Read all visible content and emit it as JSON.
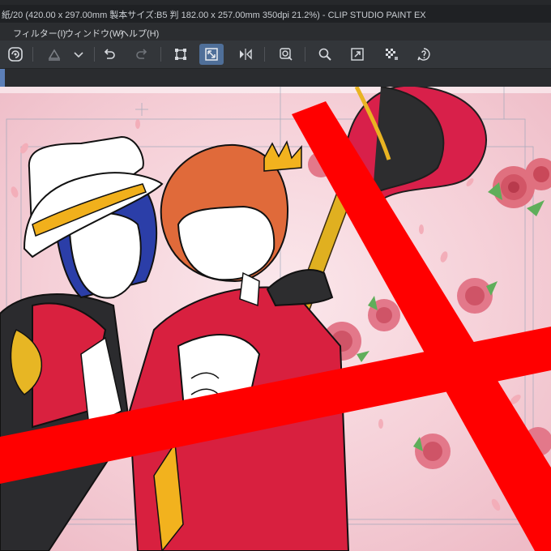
{
  "window": {
    "title": "紙/20 (420.00 x 297.00mm 製本サイズ:B5 判 182.00 x 257.00mm 350dpi 21.2%)  - CLIP STUDIO PAINT EX"
  },
  "menu": {
    "items": [
      {
        "label": "フィルター(I)"
      },
      {
        "label": "ウィンドウ(W)"
      },
      {
        "label": "ヘルプ(H)"
      }
    ]
  },
  "toolbar": {
    "icons": [
      "clip-studio-icon",
      "fill-icon",
      "dropdown-chevron-icon",
      "undo-icon",
      "redo-icon",
      "transform-icon",
      "fit-canvas-icon",
      "flip-horizontal-icon",
      "select-layer-icon",
      "zoom-icon",
      "expand-icon",
      "transparency-grid-icon",
      "help-icon"
    ],
    "active": "fit-canvas-icon",
    "accent_color": "#4f6f99"
  },
  "canvas": {
    "background_color": "#f7d6dc",
    "strike_color": "#ff0000"
  }
}
